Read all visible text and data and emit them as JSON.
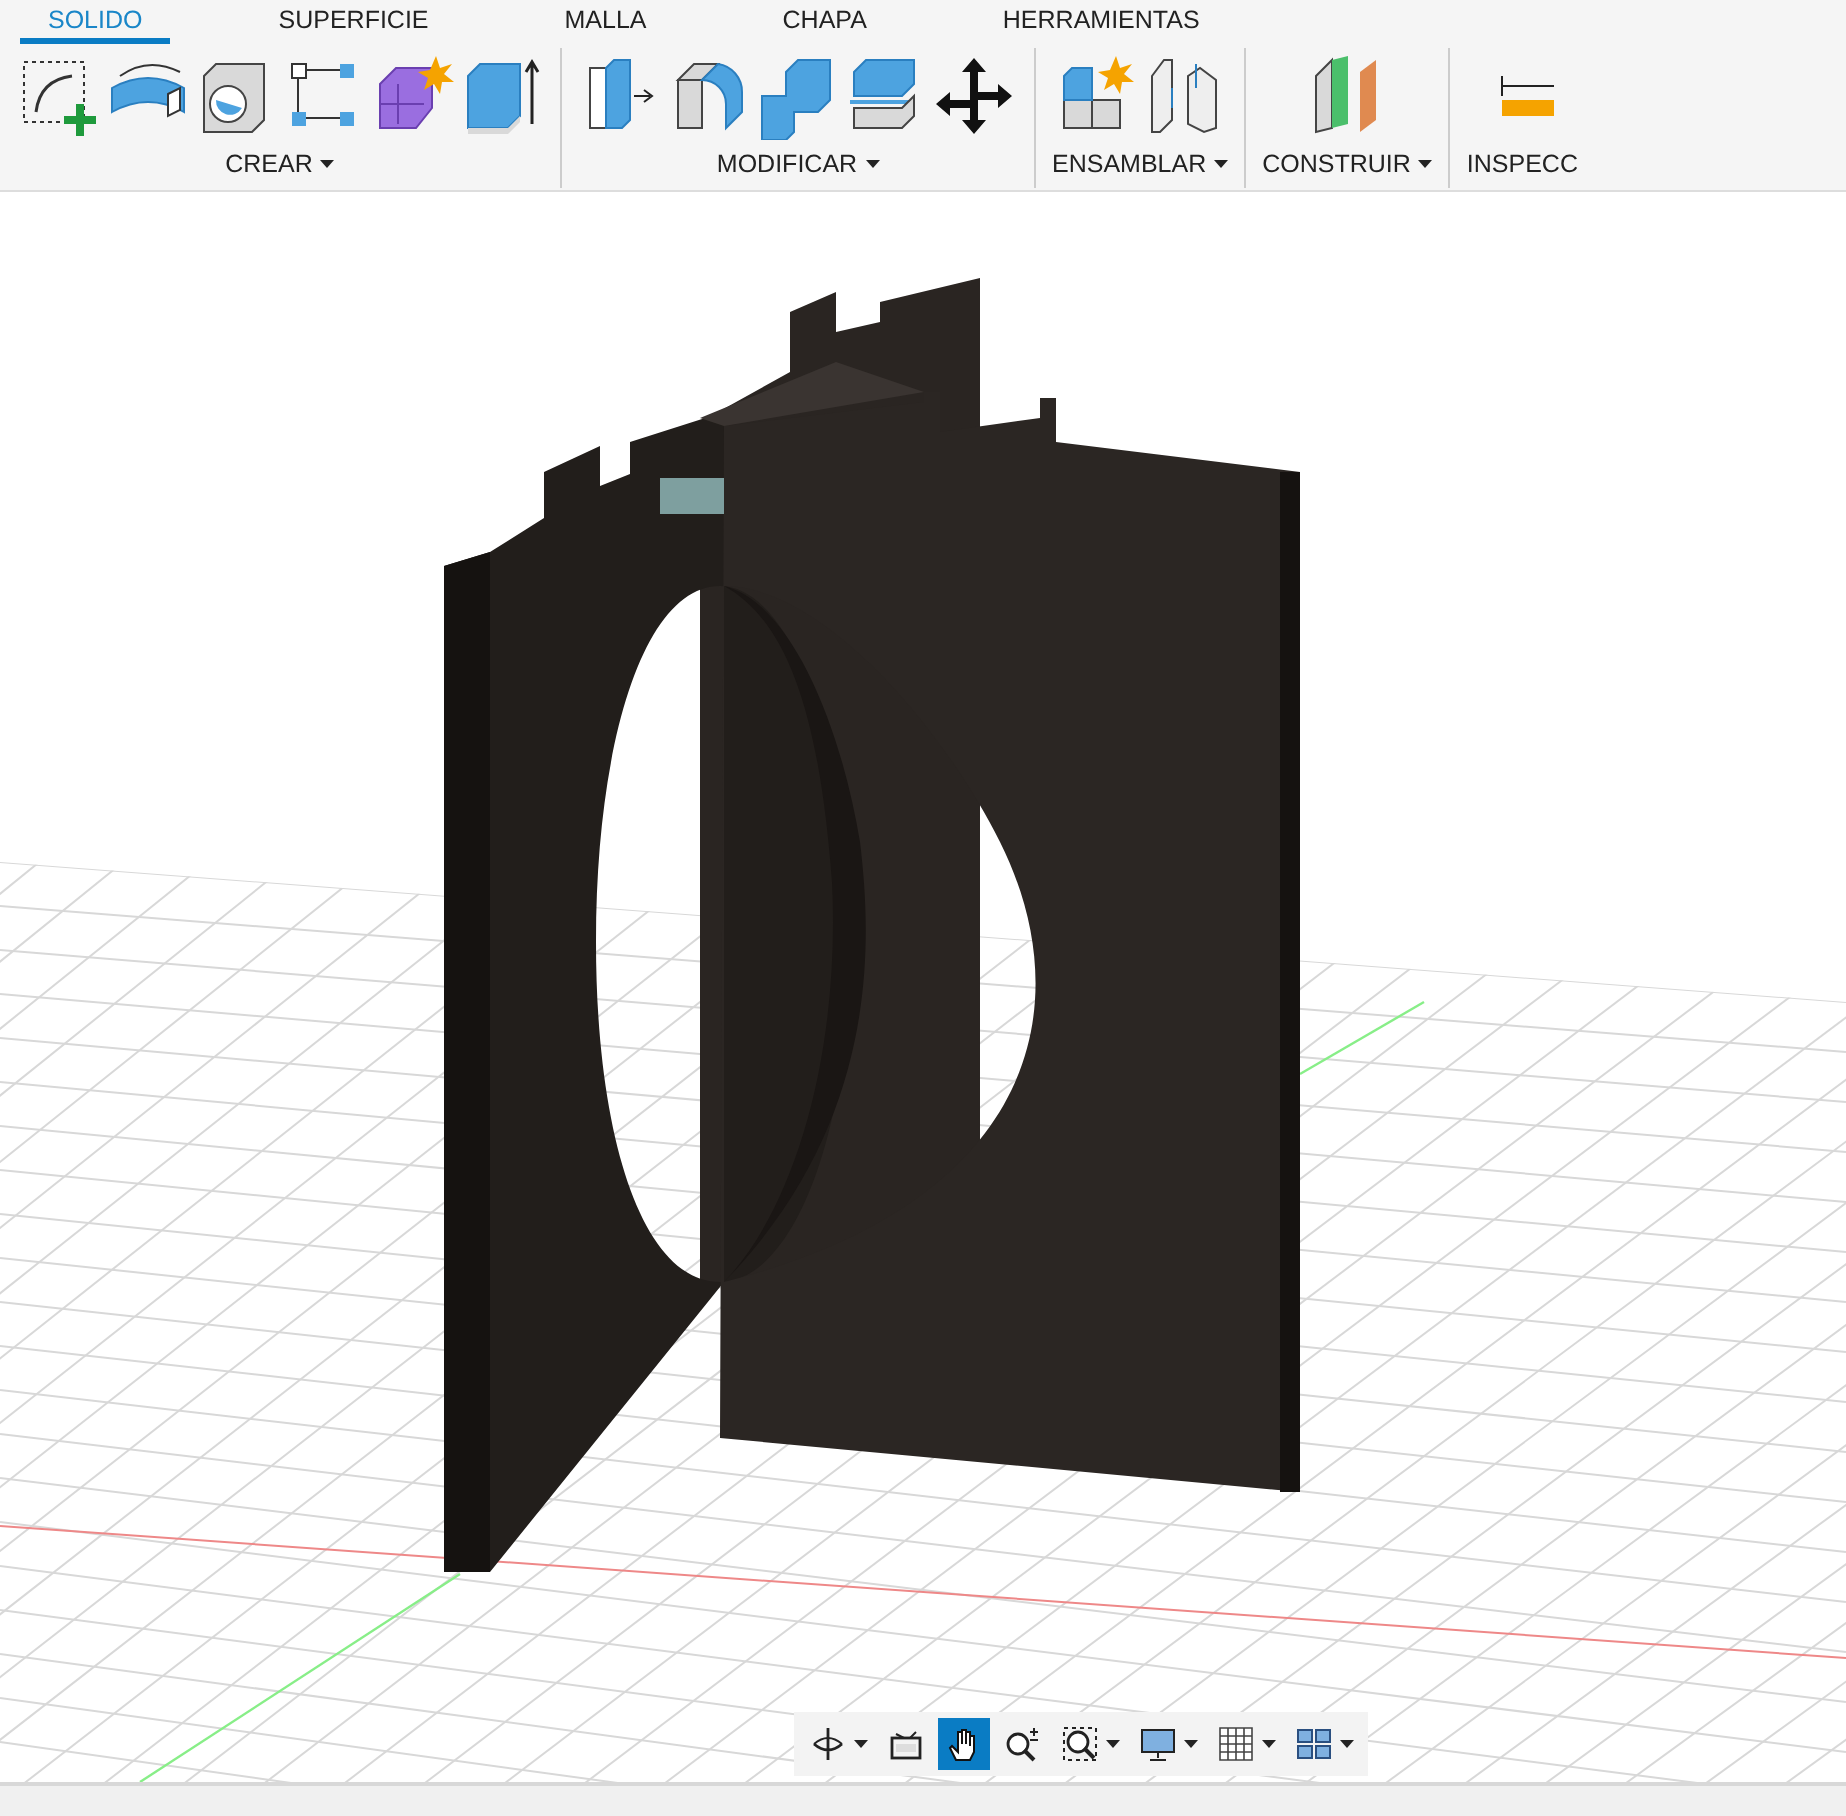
{
  "toolbar": {
    "tabs": [
      {
        "label": "SOLIDO",
        "selected": true
      },
      {
        "label": "SUPERFICIE",
        "selected": false
      },
      {
        "label": "MALLA",
        "selected": false
      },
      {
        "label": "CHAPA",
        "selected": false
      },
      {
        "label": "HERRAMIENTAS",
        "selected": false
      }
    ],
    "groups": [
      {
        "label": "CREAR"
      },
      {
        "label": "MODIFICAR"
      },
      {
        "label": "ENSAMBLAR"
      },
      {
        "label": "CONSTRUIR"
      },
      {
        "label": "INSPECC"
      }
    ]
  },
  "nav_bar": {
    "tools": [
      {
        "kind": "orbit",
        "selected": false,
        "dropdown": true
      },
      {
        "kind": "look",
        "selected": false,
        "dropdown": false
      },
      {
        "kind": "pan",
        "selected": true,
        "dropdown": false
      },
      {
        "kind": "zoom",
        "selected": false,
        "dropdown": false
      },
      {
        "kind": "fit",
        "selected": false,
        "dropdown": true
      },
      {
        "kind": "display",
        "selected": false,
        "dropdown": true
      },
      {
        "kind": "grid",
        "selected": false,
        "dropdown": true
      },
      {
        "kind": "viewports",
        "selected": false,
        "dropdown": true
      }
    ]
  }
}
